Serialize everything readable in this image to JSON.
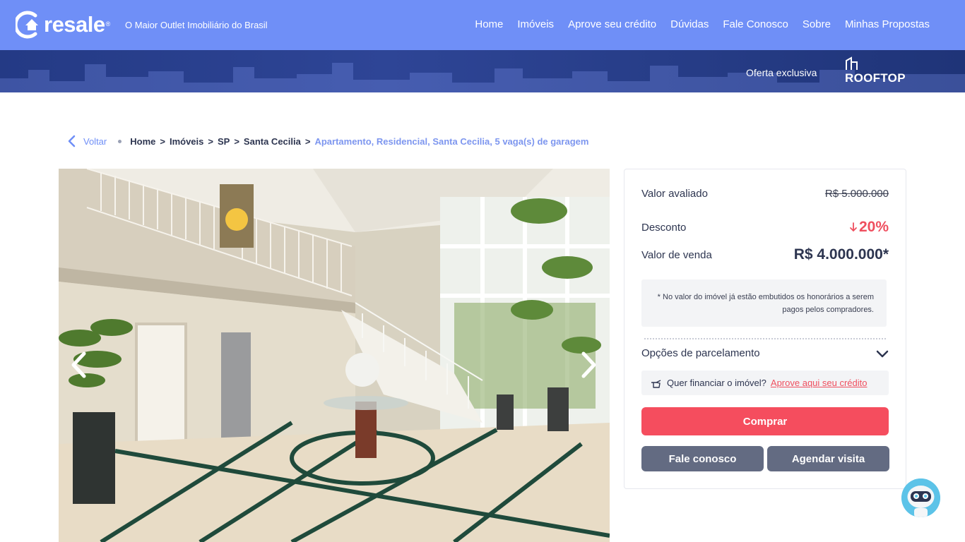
{
  "header": {
    "brand": "resale",
    "brand_mark": "®",
    "tagline": "O Maior Outlet Imobiliário do Brasil",
    "nav": [
      "Home",
      "Imóveis",
      "Aprove seu crédito",
      "Dúvidas",
      "Fale Conosco",
      "Sobre",
      "Minhas Propostas"
    ]
  },
  "banner": {
    "offer_label": "Oferta exclusiva",
    "partner": "ROOFTOP"
  },
  "breadcrumb": {
    "back_label": "Voltar",
    "items": [
      "Home",
      "Imóveis",
      "SP",
      "Santa Cecilia"
    ],
    "current": "Apartamento, Residencial, Santa Cecilia, 5 vaga(s) de garagem"
  },
  "price_card": {
    "valuation_label": "Valor avaliado",
    "valuation_value": "R$ 5.000.000",
    "discount_label": "Desconto",
    "discount_value": "20%",
    "sale_label": "Valor de venda",
    "sale_value": "R$ 4.000.000*",
    "note": "* No valor do imóvel já estão embutidos os honorários a serem pagos pelos compradores.",
    "installments_label": "Opções de parcelamento",
    "finance_text": "Quer financiar o imóvel?",
    "finance_link": "Aprove aqui seu crédito",
    "buy_button": "Comprar",
    "contact_button": "Fale conosco",
    "visit_button": "Agendar visita"
  },
  "colors": {
    "header": "#6f8ff7",
    "banner": "#2b4190",
    "accent_red": "#f54d5e",
    "secondary_button": "#636b82"
  }
}
